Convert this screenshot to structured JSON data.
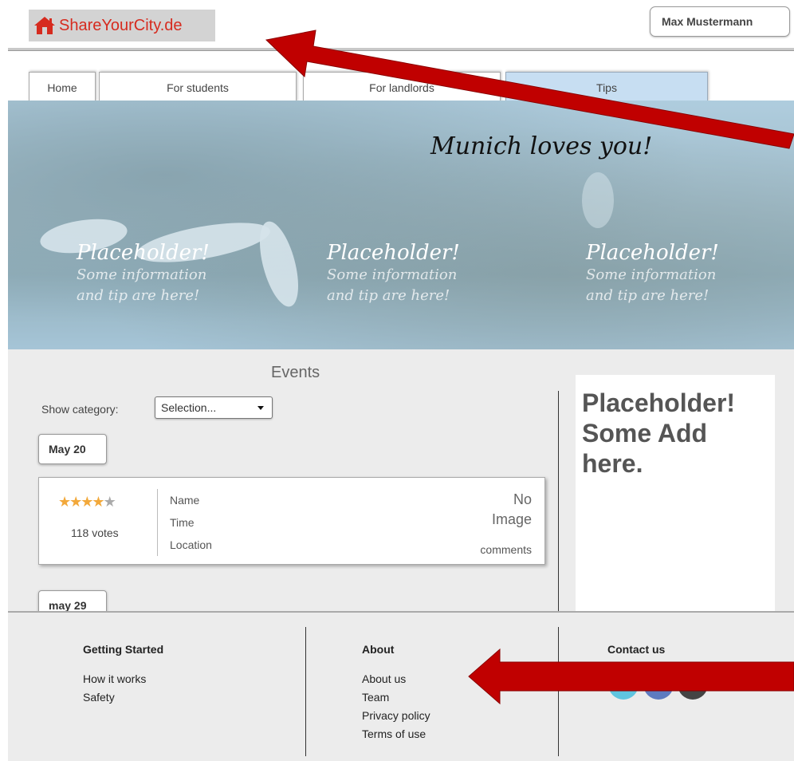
{
  "header": {
    "logo_text": "ShareYourCity.de",
    "user_name": "Max Mustermann"
  },
  "tabs": [
    {
      "label": "Home"
    },
    {
      "label": "For students"
    },
    {
      "label": "For landlords"
    },
    {
      "label": "Tips"
    }
  ],
  "hero": {
    "title": "Munich loves you!",
    "placeholders": [
      {
        "title": "Placeholder!",
        "line1": "Some information",
        "line2": "and tip are here!"
      },
      {
        "title": "Placeholder!",
        "line1": "Some information",
        "line2": "and tip are here!"
      },
      {
        "title": "Placeholder!",
        "line1": "Some information",
        "line2": "and tip are here!"
      }
    ]
  },
  "events": {
    "title": "Events",
    "category_label": "Show category:",
    "category_selected": "Selection...",
    "dates": [
      "May 20",
      "may 29"
    ],
    "card": {
      "rating": 4,
      "rating_max": 5,
      "votes": "118 votes",
      "name": "Name",
      "time": "Time",
      "location": "Location",
      "no_image_1": "No",
      "no_image_2": "Image",
      "comments": "comments"
    }
  },
  "ad": {
    "text": "Placeholder! Some Add here."
  },
  "footer": {
    "getting_started": {
      "heading": "Getting Started",
      "links": [
        "How it works",
        "Safety"
      ]
    },
    "about": {
      "heading": "About",
      "links": [
        "About us",
        "Team",
        "Privacy policy",
        "Terms of use"
      ]
    },
    "contact": {
      "heading": "Contact us",
      "social": [
        "twitter",
        "facebook",
        "google-plus"
      ]
    },
    "social_gplus_label": "+1",
    "social_fb_label": "f"
  },
  "colors": {
    "logo_red": "#d62b1f",
    "arrow_red": "#c00000",
    "tab_active": "#c7def2",
    "twitter": "#5fc5e0",
    "facebook": "#5d7bc0",
    "gplus": "#444444"
  }
}
